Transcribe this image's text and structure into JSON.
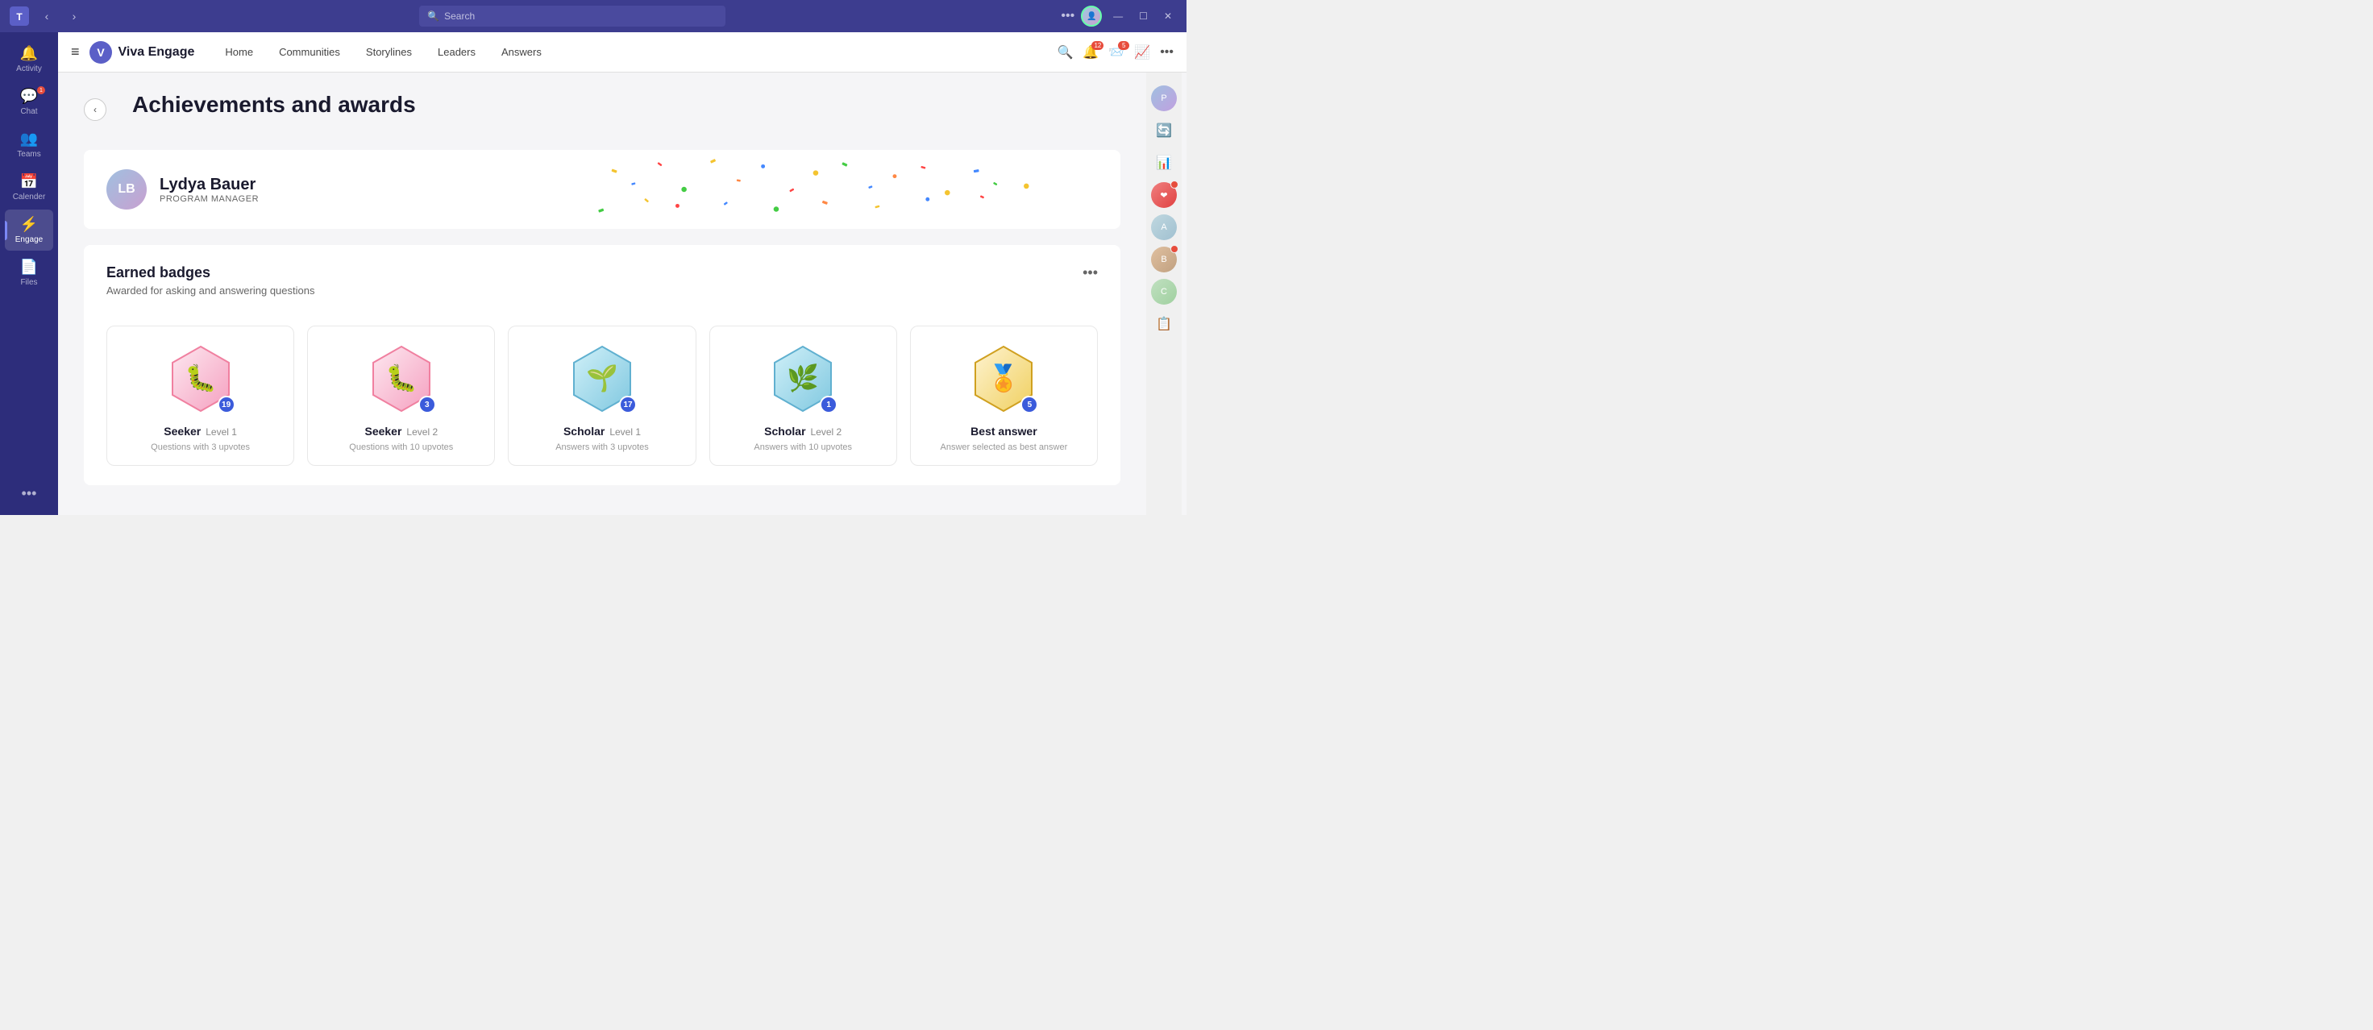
{
  "titlebar": {
    "search_placeholder": "Search",
    "nav_back": "‹",
    "nav_forward": "›",
    "more_label": "•••",
    "controls": {
      "minimize": "—",
      "maximize": "☐",
      "close": "✕"
    }
  },
  "sidebar": {
    "items": [
      {
        "id": "activity",
        "label": "Activity",
        "icon": "🔔",
        "badge": null
      },
      {
        "id": "chat",
        "label": "Chat",
        "icon": "💬",
        "badge": "1"
      },
      {
        "id": "teams",
        "label": "Teams",
        "icon": "👥",
        "badge": null
      },
      {
        "id": "calendar",
        "label": "Calender",
        "icon": "📅",
        "badge": null
      },
      {
        "id": "engage",
        "label": "Engage",
        "icon": "⚡",
        "badge": null
      },
      {
        "id": "files",
        "label": "Files",
        "icon": "📄",
        "badge": null
      }
    ],
    "more_icon": "•••"
  },
  "topnav": {
    "hamburger": "≡",
    "app_name": "Viva Engage",
    "nav_links": [
      {
        "id": "home",
        "label": "Home"
      },
      {
        "id": "communities",
        "label": "Communities"
      },
      {
        "id": "storylines",
        "label": "Storylines"
      },
      {
        "id": "leaders",
        "label": "Leaders"
      },
      {
        "id": "answers",
        "label": "Answers"
      }
    ],
    "actions": {
      "search_icon": "🔍",
      "notifications_icon": "🔔",
      "notifications_badge": "12",
      "inbox_icon": "📨",
      "inbox_badge": "5",
      "analytics_icon": "📈",
      "more_icon": "•••"
    }
  },
  "page": {
    "back_button": "‹",
    "title": "Achievements and awards",
    "profile": {
      "name": "Lydya Bauer",
      "role": "PROGRAM MANAGER",
      "avatar_initial": "LB"
    },
    "badges_section": {
      "title": "Earned badges",
      "subtitle": "Awarded for asking and answering questions",
      "more_btn": "•••",
      "badges": [
        {
          "id": "seeker-l1",
          "name": "Seeker",
          "level": "Level 1",
          "description": "Questions with 3 upvotes",
          "count": "19",
          "emoji": "🐛",
          "hex_color": "pink"
        },
        {
          "id": "seeker-l2",
          "name": "Seeker",
          "level": "Level 2",
          "description": "Questions with 10 upvotes",
          "count": "3",
          "emoji": "🐛",
          "hex_color": "pink"
        },
        {
          "id": "scholar-l1",
          "name": "Scholar",
          "level": "Level 1",
          "description": "Answers with 3 upvotes",
          "count": "17",
          "emoji": "🌱",
          "hex_color": "teal"
        },
        {
          "id": "scholar-l2",
          "name": "Scholar",
          "level": "Level 2",
          "description": "Answers with 10 upvotes",
          "count": "1",
          "emoji": "🌿",
          "hex_color": "teal"
        },
        {
          "id": "best-answer",
          "name": "Best answer",
          "level": "",
          "description": "Answer selected as best answer",
          "count": "5",
          "emoji": "🏅",
          "hex_color": "gold"
        }
      ]
    }
  },
  "right_sidebar": {
    "items": [
      {
        "type": "avatar",
        "initial": "P",
        "badge": false
      },
      {
        "type": "icon",
        "icon": "🔄"
      },
      {
        "type": "icon",
        "icon": "📊"
      },
      {
        "type": "avatar",
        "initial": "❤",
        "badge": true
      },
      {
        "type": "avatar",
        "initial": "A",
        "badge": false
      },
      {
        "type": "avatar",
        "initial": "B",
        "badge": true
      },
      {
        "type": "avatar",
        "initial": "C",
        "badge": false
      },
      {
        "type": "icon",
        "icon": "📋"
      }
    ]
  }
}
